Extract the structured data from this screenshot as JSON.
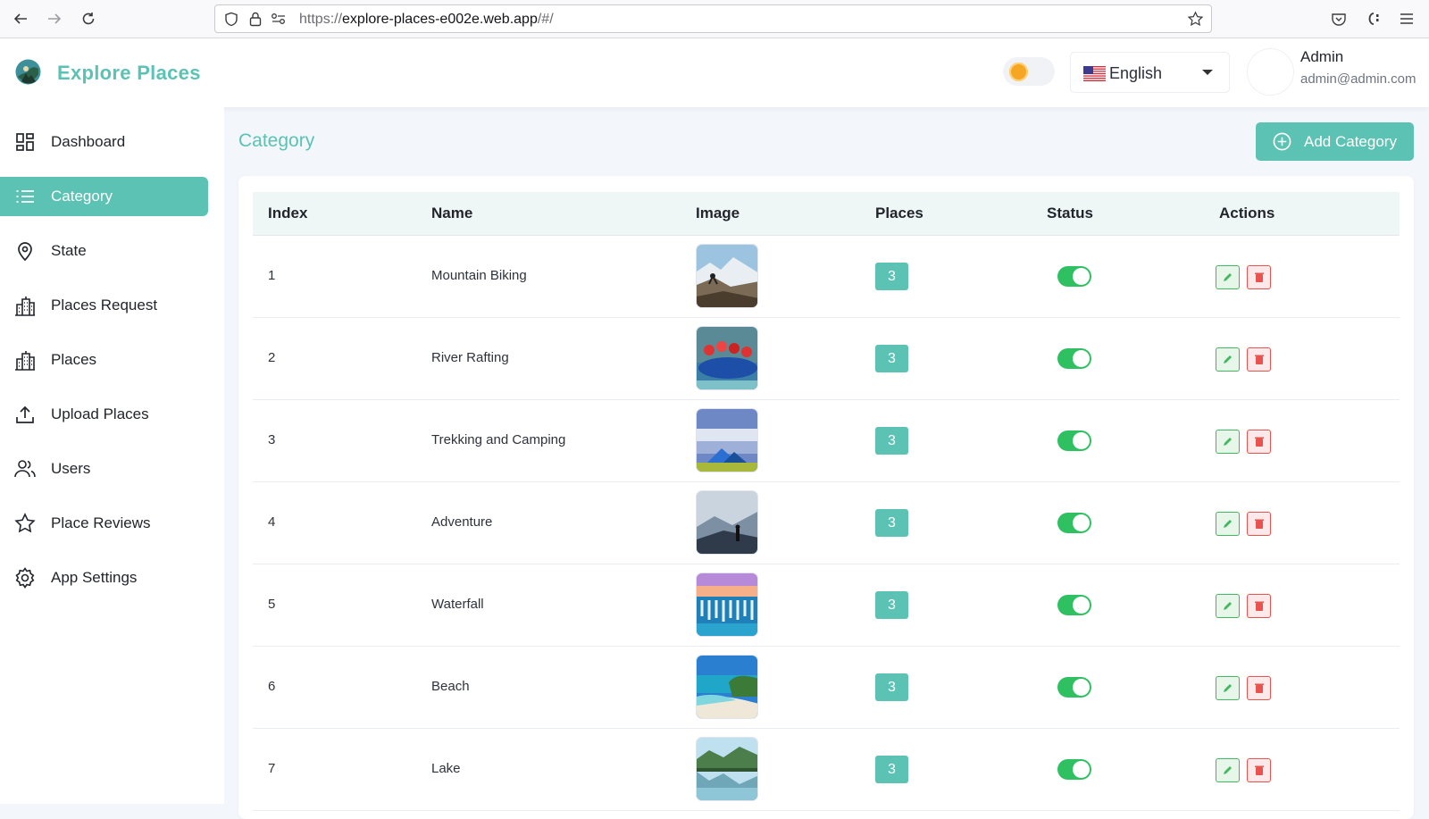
{
  "browser": {
    "url_prefix": "https://",
    "url_host": "explore-places-e002e.web.app",
    "url_path": "/#/"
  },
  "header": {
    "brand_name": "Explore Places",
    "language": "English",
    "user_name": "Admin",
    "user_email": "admin@admin.com"
  },
  "sidebar": {
    "items": [
      {
        "label": "Dashboard",
        "icon": "dashboard-icon"
      },
      {
        "label": "Category",
        "icon": "list-icon"
      },
      {
        "label": "State",
        "icon": "map-pin-icon"
      },
      {
        "label": "Places Request",
        "icon": "building-icon"
      },
      {
        "label": "Places",
        "icon": "building-icon"
      },
      {
        "label": "Upload Places",
        "icon": "upload-icon"
      },
      {
        "label": "Users",
        "icon": "users-icon"
      },
      {
        "label": "Place Reviews",
        "icon": "star-icon"
      },
      {
        "label": "App Settings",
        "icon": "gear-icon"
      }
    ],
    "active": "Category"
  },
  "main": {
    "page_title": "Category",
    "add_button_label": "Add Category",
    "columns": [
      "Index",
      "Name",
      "Image",
      "Places",
      "Status",
      "Actions"
    ],
    "rows": [
      {
        "index": "1",
        "name": "Mountain Biking",
        "places": "3",
        "status": true
      },
      {
        "index": "2",
        "name": "River Rafting",
        "places": "3",
        "status": true
      },
      {
        "index": "3",
        "name": "Trekking and Camping",
        "places": "3",
        "status": true
      },
      {
        "index": "4",
        "name": "Adventure",
        "places": "3",
        "status": true
      },
      {
        "index": "5",
        "name": "Waterfall",
        "places": "3",
        "status": true
      },
      {
        "index": "6",
        "name": "Beach",
        "places": "3",
        "status": true
      },
      {
        "index": "7",
        "name": "Lake",
        "places": "3",
        "status": true
      }
    ]
  },
  "colors": {
    "accent": "#5cc2b3",
    "switch_on": "#2ec061",
    "edit": "#42b85e",
    "delete": "#e9534f"
  }
}
